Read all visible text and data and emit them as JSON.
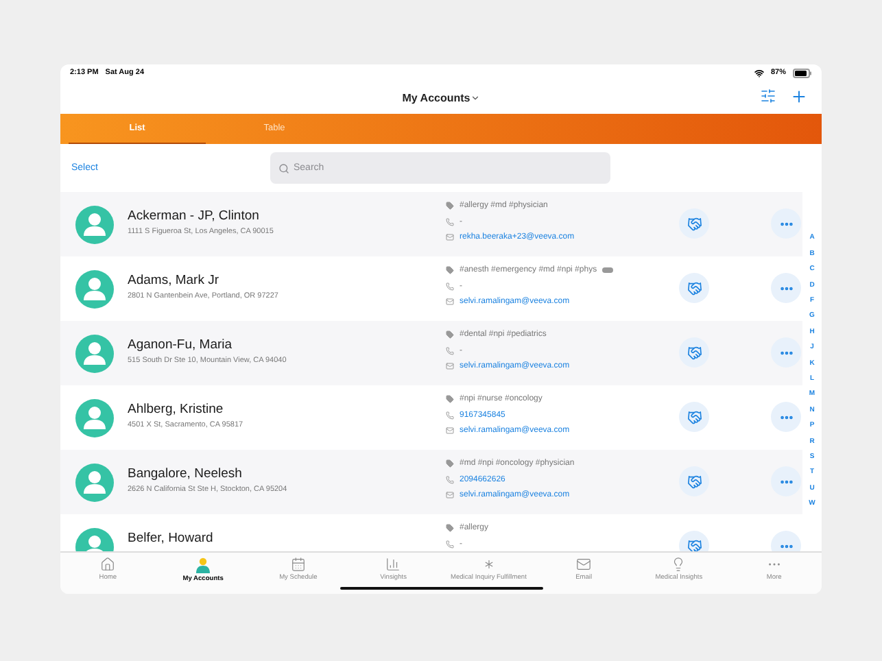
{
  "status_bar": {
    "time": "2:13 PM",
    "date": "Sat Aug 24",
    "battery": "87%"
  },
  "nav": {
    "title": "My Accounts"
  },
  "tabs": [
    {
      "label": "List",
      "selected": true
    },
    {
      "label": "Table",
      "selected": false
    }
  ],
  "toolbar": {
    "select": "Select",
    "search": {
      "placeholder": "Search"
    }
  },
  "accounts": [
    {
      "name": "Ackerman - JP, Clinton",
      "address": "1111 S Figueroa St, Los Angeles, CA 90015",
      "tags": "#allergy #md #physician",
      "tags_truncated": false,
      "phone": {
        "text": "-",
        "linked": false
      },
      "email": "rekha.beeraka+23@veeva.com"
    },
    {
      "name": "Adams, Mark Jr",
      "address": "2801 N Gantenbein Ave, Portland, OR 97227",
      "tags": "#anesth #emergency #md #npi #phys",
      "tags_truncated": true,
      "phone": {
        "text": "-",
        "linked": false
      },
      "email": "selvi.ramalingam@veeva.com"
    },
    {
      "name": "Aganon-Fu, Maria",
      "address": "515 South Dr Ste 10, Mountain View, CA 94040",
      "tags": "#dental #npi #pediatrics",
      "tags_truncated": false,
      "phone": {
        "text": "-",
        "linked": false
      },
      "email": "selvi.ramalingam@veeva.com"
    },
    {
      "name": "Ahlberg, Kristine",
      "address": "4501 X St, Sacramento, CA 95817",
      "tags": "#npi #nurse #oncology",
      "tags_truncated": false,
      "phone": {
        "text": "9167345845",
        "linked": true
      },
      "email": "selvi.ramalingam@veeva.com"
    },
    {
      "name": "Bangalore, Neelesh",
      "address": "2626 N California St Ste H, Stockton, CA 95204",
      "tags": "#md #npi #oncology #physician",
      "tags_truncated": false,
      "phone": {
        "text": "2094662626",
        "linked": true
      },
      "email": "selvi.ramalingam@veeva.com"
    },
    {
      "name": "Belfer, Howard",
      "tags": "#allergy",
      "tags_truncated": false,
      "phone": {
        "text": "-",
        "linked": false
      }
    }
  ],
  "index": [
    "A",
    "B",
    "C",
    "D",
    "F",
    "G",
    "H",
    "J",
    "K",
    "L",
    "M",
    "N",
    "P",
    "R",
    "S",
    "T",
    "U",
    "W"
  ],
  "tab_bar": [
    {
      "kind": "home",
      "label": "Home",
      "selected": false
    },
    {
      "kind": "accounts",
      "label": "My Accounts",
      "selected": true
    },
    {
      "kind": "schedule",
      "label": "My Schedule",
      "selected": false
    },
    {
      "kind": "chart",
      "label": "Vinsights",
      "selected": false
    },
    {
      "kind": "medical",
      "label": "Medical Inquiry Fulfillment",
      "selected": false
    },
    {
      "kind": "email",
      "label": "Email",
      "selected": false
    },
    {
      "kind": "insight",
      "label": "Medical Insights",
      "selected": false
    },
    {
      "kind": "more",
      "label": "More",
      "selected": false
    }
  ]
}
